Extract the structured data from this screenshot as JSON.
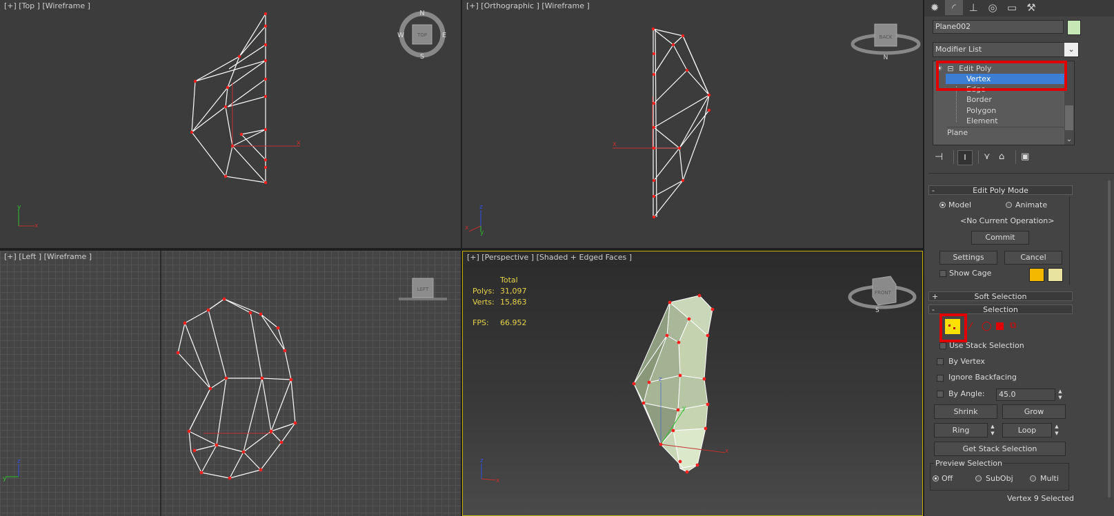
{
  "viewports": {
    "top": {
      "label": "[+] [Top ] [Wireframe ]",
      "viewcube": {
        "n": "N",
        "s": "S",
        "e": "E",
        "w": "W",
        "face": "TOP"
      }
    },
    "ortho": {
      "label": "[+] [Orthographic ] [Wireframe ]",
      "viewcube": {
        "face": "BACK",
        "n": "N"
      }
    },
    "left": {
      "label": "[+] [Left ] [Wireframe ]",
      "viewcube": {
        "face": "LEFT"
      }
    },
    "persp": {
      "label": "[+] [Perspective ] [Shaded + Edged Faces ]",
      "viewcube": {
        "face": "FRONT",
        "s": "S"
      },
      "stats": {
        "total_label": "Total",
        "polys_label": "Polys:",
        "polys": "31,097",
        "verts_label": "Verts:",
        "verts": "15,863",
        "fps_label": "FPS:",
        "fps": "66.952"
      }
    }
  },
  "axes": {
    "x": "x",
    "y": "y",
    "z": "z"
  },
  "panel": {
    "tabs": [
      "create-icon",
      "modify-icon",
      "hierarchy-icon",
      "motion-icon",
      "display-icon",
      "utilities-icon"
    ],
    "object_name": "Plane002",
    "object_color": "#c7e8b5",
    "modifier_list": "Modifier List",
    "stack": {
      "edit_poly": "Edit Poly",
      "vertex": "Vertex",
      "edge": "Edge",
      "border": "Border",
      "polygon": "Polygon",
      "element": "Element",
      "plane": "Plane"
    },
    "edit_poly_mode": {
      "title": "Edit Poly Mode",
      "model": "Model",
      "animate": "Animate",
      "no_op": "<No Current Operation>",
      "commit": "Commit",
      "settings": "Settings",
      "cancel": "Cancel",
      "show_cage": "Show Cage",
      "cage_color1": "#f5b800",
      "cage_color2": "#e8e4a0"
    },
    "soft_selection": "Soft Selection",
    "selection": {
      "title": "Selection",
      "use_stack": "Use Stack Selection",
      "by_vertex": "By Vertex",
      "ignore_backfacing": "Ignore Backfacing",
      "by_angle": "By Angle:",
      "angle_value": "45.0",
      "shrink": "Shrink",
      "grow": "Grow",
      "ring": "Ring",
      "loop": "Loop",
      "get_stack": "Get Stack Selection",
      "preview": "Preview Selection",
      "off": "Off",
      "subobj": "SubObj",
      "multi": "Multi",
      "status": "Vertex 9 Selected"
    },
    "highlight_color": "#e00000",
    "selection_active": "#3a7fd5"
  }
}
